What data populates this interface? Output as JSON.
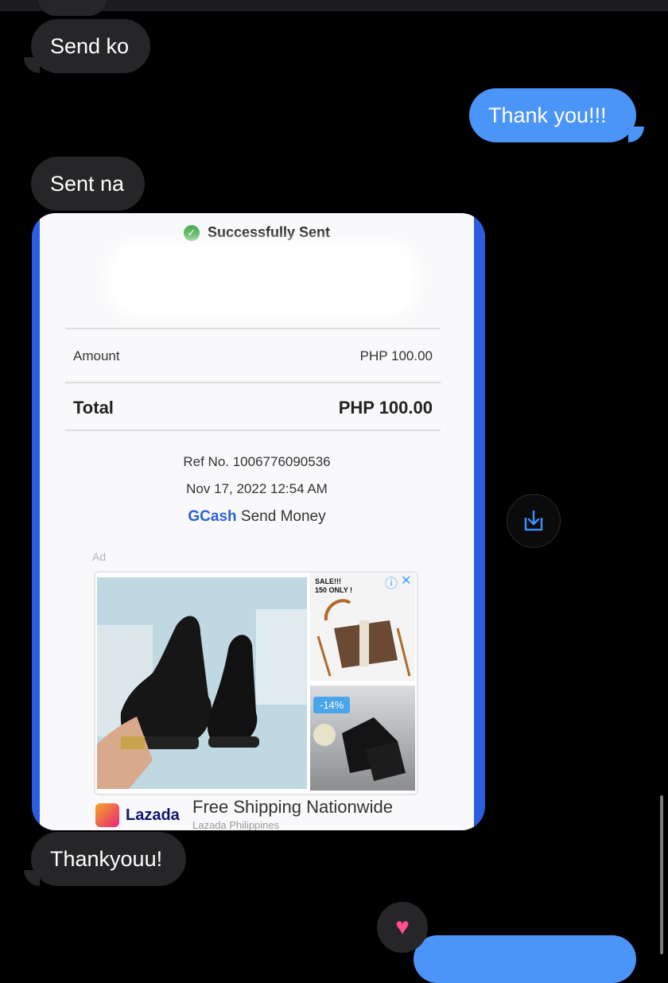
{
  "messages": {
    "m1": "Send ko",
    "m2": "Thank you!!!",
    "m3": "Sent na",
    "m4": "Thankyouu!"
  },
  "receipt": {
    "status": "Successfully Sent",
    "amount_label": "Amount",
    "amount_value": "PHP 100.00",
    "total_label": "Total",
    "total_value": "PHP 100.00",
    "ref": "Ref No. 1006776090536",
    "datetime": "Nov 17, 2022 12:54 AM",
    "brand": "GCash",
    "action": "Send Money"
  },
  "ad": {
    "label": "Ad",
    "sale_text": "SALE!!! 150 ONLY !",
    "discount": "-14%",
    "advertiser": "Lazada",
    "headline": "Free Shipping Nationwide",
    "sub": "Lazada Philippines"
  },
  "icons": [
    "checkmark-icon",
    "download-icon",
    "heart-icon",
    "info-icon",
    "close-icon"
  ],
  "colors": {
    "incoming_bubble": "#262628",
    "outgoing_bubble": "#4c95f8",
    "gcash_blue": "#2a5fd8"
  }
}
